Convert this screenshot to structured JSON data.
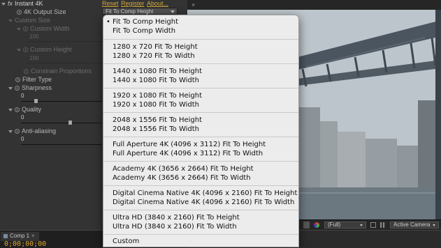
{
  "effect": {
    "name": "Instant 4K",
    "badge": "fx",
    "links": {
      "reset": "Reset",
      "register": "Register",
      "about": "About..."
    },
    "output_size_label": "4K Output Size",
    "output_size_value": "Fit To Comp Height",
    "custom_size_label": "Custom Size",
    "custom_width_label": "Custom Width",
    "custom_width_value": "100",
    "custom_height_label": "Custom Height",
    "custom_height_value": "100",
    "constrain_label": "Constrain Proportions",
    "filter_type_label": "Filter Type",
    "sharpness_label": "Sharpness",
    "sharpness_value": "0",
    "quality_label": "Quality",
    "quality_value": "0",
    "antialiasing_label": "Anti-aliasing",
    "antialiasing_value": "0"
  },
  "viewer": {
    "resolution": "(Full)",
    "camera": "Active Camera",
    "tab_close": "×"
  },
  "timeline": {
    "comp_tab": "Comp 1",
    "tab_close": "×",
    "timecode": "0;00;00;00"
  },
  "menu": {
    "selected_index": 0,
    "check_glyph": "•",
    "groups": [
      [
        "Fit To Comp Height",
        "Fit To Comp Width"
      ],
      [
        "1280 x 720 Fit To Height",
        "1280 x 720 Fit To Width"
      ],
      [
        "1440 x 1080 Fit To Height",
        "1440 x 1080 Fit To Width"
      ],
      [
        "1920 x 1080 Fit To Height",
        "1920 x 1080 Fit To Width"
      ],
      [
        "2048 x 1556 Fit To Height",
        "2048 x 1556 Fit To Width"
      ],
      [
        "Full Aperture 4K (4096 x 3112) Fit To Height",
        "Full Aperture 4K (4096 x 3112) Fit To Width"
      ],
      [
        "Academy 4K (3656 x 2664) Fit To Height",
        "Academy 4K (3656 x 2664) Fit To Width"
      ],
      [
        "Digital Cinema Native 4K (4096 x 2160) Fit To Height",
        "Digital Cinema Native 4K (4096 x 2160) Fit To Width"
      ],
      [
        "Ultra HD (3840 x 2160) Fit To Height",
        "Ultra HD (3840 x 2160) Fit To Width"
      ],
      [
        "Custom"
      ]
    ]
  },
  "colors": {
    "accent": "#d6a93e",
    "timecode": "#e0a530",
    "panel": "#333333",
    "menu_bg": "#ececec"
  }
}
